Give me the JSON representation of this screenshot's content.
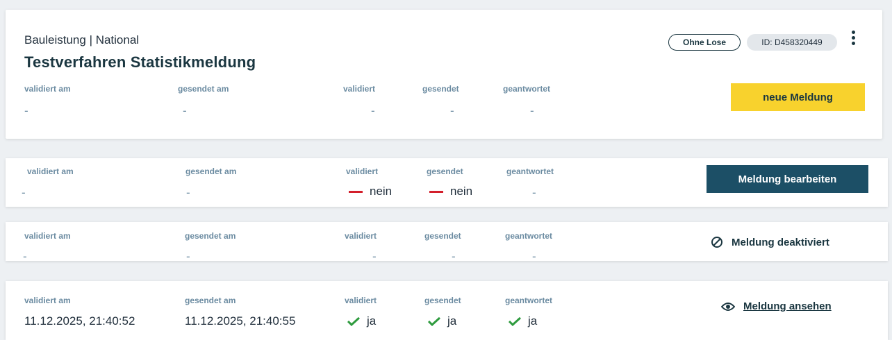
{
  "header": {
    "subtitle": "Bauleistung | National",
    "title": "Testverfahren Statistikmeldung",
    "lots_badge": "Ohne Lose",
    "id_badge": "ID: D458320449",
    "new_button": "neue Meldung"
  },
  "labels": {
    "validated_at": "validiert am",
    "sent_at": "gesendet am",
    "validated": "validiert",
    "sent": "gesendet",
    "answered": "geantwortet"
  },
  "summary": {
    "validated_at": "-",
    "sent_at": "-",
    "validated": "-",
    "sent": "-",
    "answered": "-"
  },
  "rows": [
    {
      "validated_at": "-",
      "sent_at": "-",
      "validated": "nein",
      "sent": "nein",
      "answered": "-",
      "action": "Meldung bearbeiten"
    },
    {
      "validated_at": "-",
      "sent_at": "-",
      "validated": "-",
      "sent": "-",
      "answered": "-",
      "action": "Meldung deaktiviert"
    },
    {
      "validated_at": "11.12.2025, 21:40:52",
      "sent_at": "11.12.2025, 21:40:55",
      "validated": "ja",
      "sent": "ja",
      "answered": "ja",
      "action": "Meldung ansehen"
    }
  ],
  "colors": {
    "accent_yellow": "#f8d22d",
    "primary_dark": "#1c4f66",
    "negative_red": "#d31f2b",
    "positive_green": "#2e9b3e",
    "label_blue_gray": "#6b8ba1"
  },
  "icons": {
    "kebab": "more-vertical-icon",
    "negative": "dash-icon",
    "positive": "check-icon",
    "disabled": "ban-icon",
    "view": "eye-icon"
  }
}
